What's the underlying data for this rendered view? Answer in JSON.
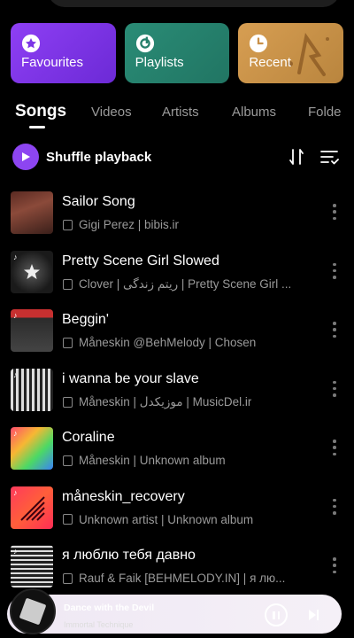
{
  "quick_access": {
    "favourites_label": "Favourites",
    "playlists_label": "Playlists",
    "recent_label": "Recent"
  },
  "tabs": [
    {
      "label": "Songs",
      "active": true
    },
    {
      "label": "Videos",
      "active": false
    },
    {
      "label": "Artists",
      "active": false
    },
    {
      "label": "Albums",
      "active": false
    },
    {
      "label": "Folde",
      "active": false
    }
  ],
  "actions": {
    "shuffle_label": "Shuffle playback"
  },
  "songs": [
    {
      "title": "Sailor Song",
      "subtitle": "Gigi Perez | bibis.ir"
    },
    {
      "title": "Pretty Scene Girl Slowed",
      "subtitle": "Clover | ریتم زندگی | Pretty Scene Girl ..."
    },
    {
      "title": "Beggin'",
      "subtitle": "Måneskin @BehMelody | Chosen"
    },
    {
      "title": "i wanna be your slave",
      "subtitle": "Måneskin | موزیکدل | MusicDel.ir"
    },
    {
      "title": "Coraline",
      "subtitle": "Måneskin | Unknown album"
    },
    {
      "title": "måneskin_recovery",
      "subtitle": "Unknown artist | Unknown album"
    },
    {
      "title": "я люблю тебя давно",
      "subtitle": "Rauf & Faik [BEHMELODY.IN] | я лю..."
    }
  ],
  "now_playing": {
    "title": "Dance with the Devil",
    "artist": "Immortal Technique"
  },
  "colors": {
    "accent": "#8d45f1",
    "favourites": "#7c35e6",
    "playlists": "#267f6b",
    "recent": "#c9914a"
  }
}
